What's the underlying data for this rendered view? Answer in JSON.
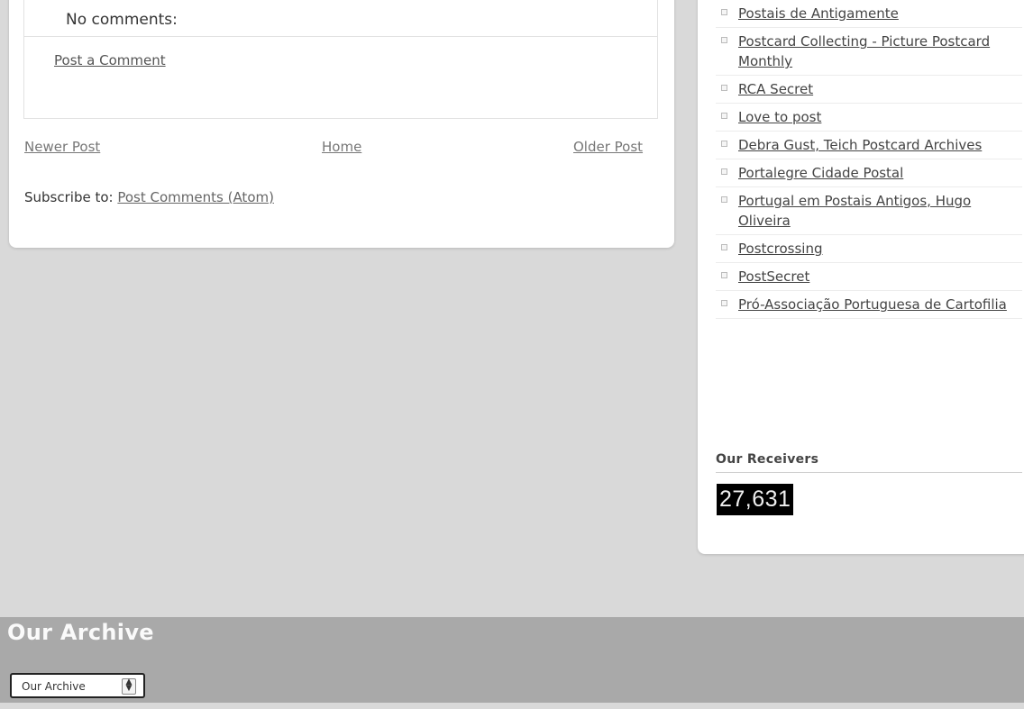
{
  "post": {
    "comments_header": "No comments:",
    "post_comment_link": "Post a Comment",
    "nav": {
      "newer": "Newer Post",
      "home": "Home",
      "older": "Older Post"
    },
    "subscribe_label": "Subscribe to: ",
    "subscribe_link": "Post Comments (Atom)"
  },
  "sidebar": {
    "links": [
      "Postais de Antigamente",
      "Postcard Collecting - Picture Postcard Monthly",
      "RCA Secret",
      "Love to post",
      "Debra Gust, Teich Postcard Archives",
      "Portalegre Cidade Postal",
      "Portugal em Postais Antigos, Hugo Oliveira",
      "Postcrossing",
      "PostSecret",
      "Pró-Associação Portuguesa de Cartofilia"
    ],
    "receivers_title": "Our Receivers",
    "receivers_count": "27,631"
  },
  "footer": {
    "archive_title": "Our Archive",
    "archive_select_value": "Our Archive"
  }
}
